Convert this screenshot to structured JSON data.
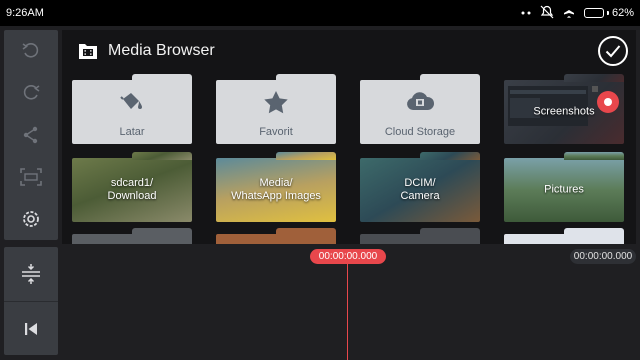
{
  "status": {
    "time": "9:26AM",
    "battery": "62%",
    "battery_level": 0.62
  },
  "toolbar": {
    "items": [
      {
        "name": "undo-icon"
      },
      {
        "name": "redo-icon"
      },
      {
        "name": "share-icon"
      },
      {
        "name": "crop-icon"
      },
      {
        "name": "settings-icon"
      }
    ]
  },
  "browser": {
    "title": "Media Browser",
    "folders": [
      {
        "label": "Latar",
        "style": "icon",
        "icon": "paint-bucket-icon"
      },
      {
        "label": "Favorit",
        "style": "icon",
        "icon": "star-icon"
      },
      {
        "label": "Cloud Storage",
        "style": "icon",
        "icon": "cloud-film-icon"
      },
      {
        "label": "Screenshots",
        "style": "photo"
      },
      {
        "label": "sdcard1/\nDownload",
        "style": "photo"
      },
      {
        "label": "Media/\nWhatsApp Images",
        "style": "photo"
      },
      {
        "label": "DCIM/\nCamera",
        "style": "photo"
      },
      {
        "label": "Pictures",
        "style": "photo"
      },
      {
        "label": "",
        "style": "photo"
      },
      {
        "label": "",
        "style": "photo"
      },
      {
        "label": "",
        "style": "photo"
      },
      {
        "label": "",
        "style": "photo"
      }
    ]
  },
  "timeline": {
    "playhead_time": "00:00:00.000",
    "total_time": "00:00:00.000"
  },
  "colors": {
    "accent": "#e8474c",
    "panel": "#3a3d42",
    "folder": "#d7d9dc",
    "folder_icon": "#5a6470"
  }
}
